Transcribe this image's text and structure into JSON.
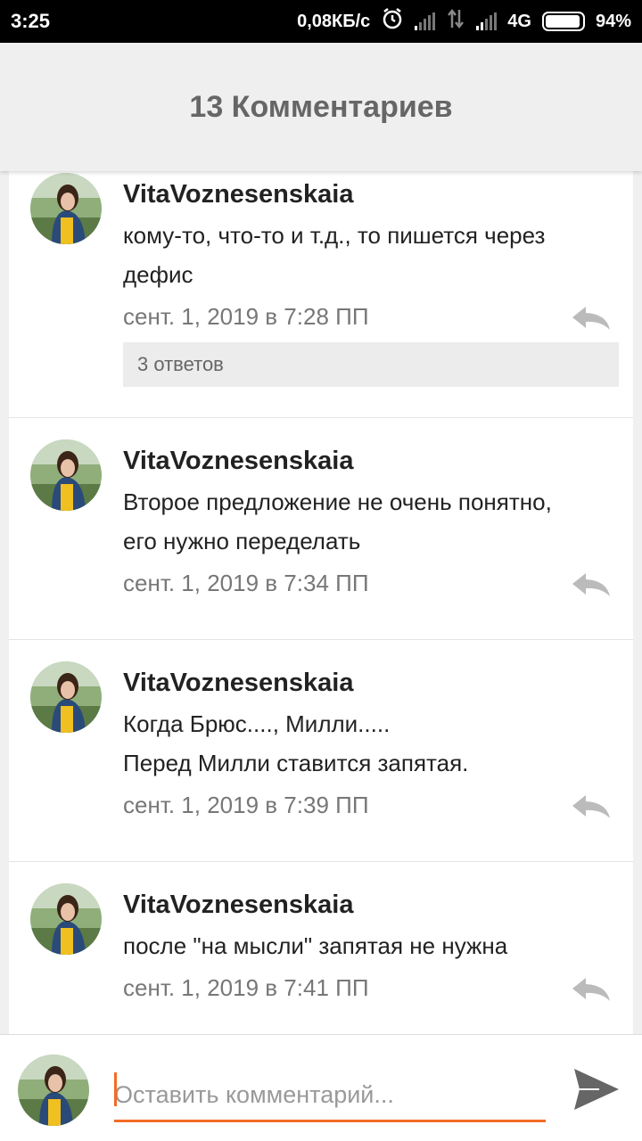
{
  "status_bar": {
    "time": "3:25",
    "network_speed": "0,08КБ/с",
    "network_type": "4G",
    "battery_percent": "94%",
    "battery_level": 0.94,
    "icons": [
      "alarm-icon",
      "signal-icon",
      "data-transfer-icon",
      "signal-icon",
      "battery-icon"
    ]
  },
  "header": {
    "title": "13 Комментариев"
  },
  "comments": [
    {
      "author": "VitaVoznesenskaia",
      "text": "кому-то, что-то и т.д., то пишется через\nдефис",
      "date": "сент. 1, 2019 в 7:28 ПП",
      "replies_label": "3 ответов"
    },
    {
      "author": "VitaVoznesenskaia",
      "text": "Второе предложение не очень понятно,\nего нужно переделать",
      "date": "сент. 1, 2019 в 7:34 ПП"
    },
    {
      "author": "VitaVoznesenskaia",
      "text": "Когда Брюс...., Милли.....\nПеред Милли ставится запятая.",
      "date": "сент. 1, 2019 в 7:39 ПП"
    },
    {
      "author": "VitaVoznesenskaia",
      "text": "после \"на мысли\" запятая не нужна",
      "date": "сент. 1, 2019 в 7:41 ПП"
    }
  ],
  "composer": {
    "placeholder": "Оставить комментарий...",
    "value": "",
    "send_icon": "send-icon"
  },
  "colors": {
    "accent": "#f36c24",
    "header_bg": "#efefef",
    "muted_text": "#777777",
    "icon_gray": "#bbbbbb"
  }
}
